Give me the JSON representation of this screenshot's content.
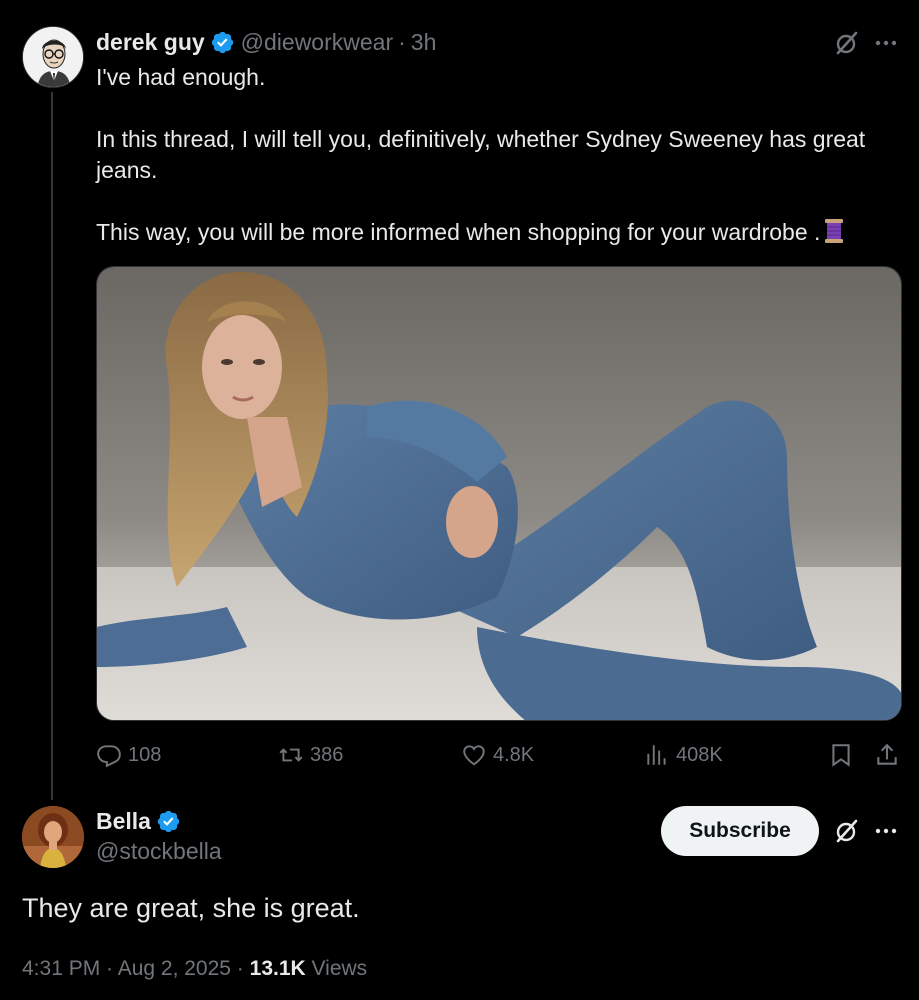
{
  "tweet": {
    "author": {
      "display_name": "derek guy",
      "handle": "@dieworkwear",
      "verified": true
    },
    "separator": "·",
    "time_ago": "3h",
    "paragraphs": [
      "I've had enough.",
      "In this thread, I will tell you, definitively, whether Sydney Sweeney has great jeans.",
      "This way, you will be more informed when shopping for your wardrobe ."
    ],
    "media_icon": "sewing-spool-emoji",
    "stats": {
      "replies": "108",
      "reposts": "386",
      "likes": "4.8K",
      "views": "408K"
    }
  },
  "reply": {
    "author": {
      "display_name": "Bella",
      "handle": "@stockbella",
      "verified": true
    },
    "subscribe_label": "Subscribe",
    "text": "They are great, she is great.",
    "timestamp": "4:31 PM · Aug 2, 2025 · ",
    "views_count": "13.1K",
    "views_label": " Views"
  },
  "colors": {
    "background": "#000000",
    "text_primary": "#e7e9ea",
    "text_secondary": "#71767b",
    "verified_blue": "#1d9bf0",
    "subscribe_bg": "#eff3f4"
  }
}
